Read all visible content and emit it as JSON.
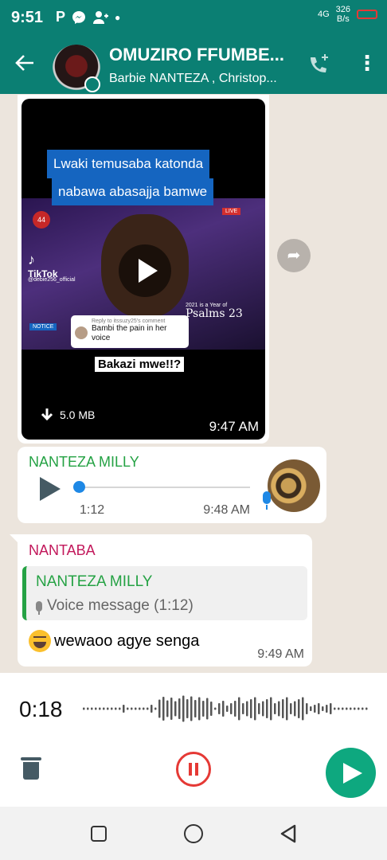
{
  "status_bar": {
    "time": "9:51",
    "icons": [
      "P",
      "messenger-icon",
      "person-add-icon",
      "dot-icon"
    ],
    "network_speed_value": "326",
    "network_speed_unit": "B/s",
    "signal_label": "4G"
  },
  "chat_header": {
    "title": "OMUZIRO FFUMBE...",
    "subtitle": "Barbie NANTEZA , Christop...",
    "accent_color": "#0b7f73"
  },
  "messages": {
    "video": {
      "caption_line1": "Lwaki temusaba katonda",
      "caption_line2": "nabawa abasajja bamwe",
      "tiktok_label": "TikTok",
      "tiktok_handle": "@debie256_official",
      "channel_badge": "44",
      "live_badge": "LIVE",
      "notice_label": "NOTICE",
      "overlay_year": "2021 is a Year of",
      "overlay_psalm": "Psalms 23",
      "reply_header": "Reply to itssuzy25's comment",
      "reply_text": "Bambi the pain in her voice",
      "bakazi_text": "Bakazi mwe!!?",
      "file_size": "5.0 MB",
      "time": "9:47 AM"
    },
    "voice": {
      "sender": "NANTEZA MILLY",
      "sender_color": "#25a244",
      "duration": "1:12",
      "time": "9:48 AM",
      "progress": 0
    },
    "reply": {
      "sender": "NANTABA",
      "sender_color": "#c2185b",
      "quoted_sender": "NANTEZA MILLY",
      "quoted_text": "Voice message (1:12)",
      "text": "wewaoo agye senga",
      "time": "9:49 AM"
    }
  },
  "recorder": {
    "elapsed": "0:18"
  }
}
